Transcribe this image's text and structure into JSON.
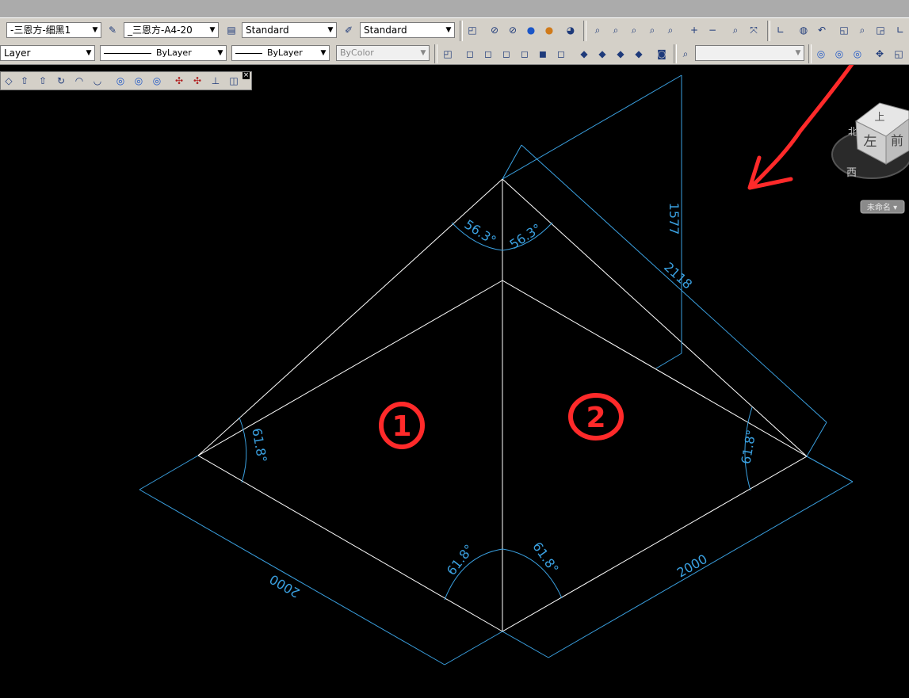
{
  "toolbar1": {
    "text_style_combo": "-三恩方-细黑1",
    "dim_style_combo": "_三恩方-A4-20",
    "table_style_combo": "Standard",
    "multileader_style_combo": "Standard"
  },
  "toolbar2": {
    "layer_combo": "Layer",
    "linetype_combo": "ByLayer",
    "lineweight_combo": "ByLayer",
    "color_combo": "ByColor",
    "blank_combo": ""
  },
  "viewcube": {
    "top": "上",
    "left": "左",
    "front": "前",
    "compass_west": "西",
    "compass_north": "北",
    "ucs_menu": "未命名 ▾"
  },
  "dimensions": {
    "angle_top_left": "56.3°",
    "angle_top_right": "56.3°",
    "height": "1577",
    "slant_length": "2118",
    "angle_left": "61.8°",
    "angle_right": "61.8°",
    "angle_bottom_left": "61.8°",
    "angle_bottom_right": "61.8°",
    "length_left": "2000",
    "length_right": "2000"
  },
  "annotations": {
    "label_1": "1",
    "label_2": "2"
  },
  "colors": {
    "canvas": "#000000",
    "geometry": "#ffffff",
    "dimension": "#3aa0e0",
    "markup": "#ff2a2a",
    "toolbar": "#d4d0c8"
  }
}
